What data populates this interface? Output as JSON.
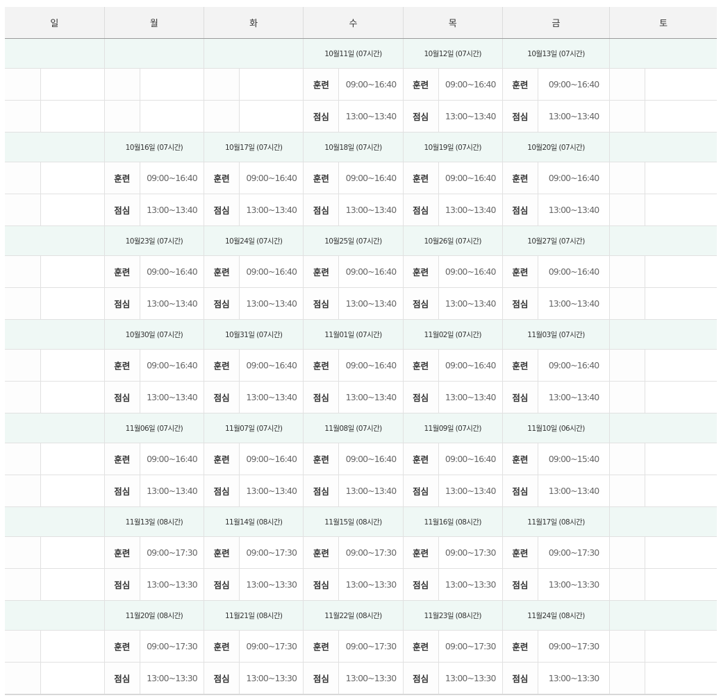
{
  "days": [
    "일",
    "월",
    "화",
    "수",
    "목",
    "금",
    "토"
  ],
  "weeks": [
    {
      "days": [
        null,
        null,
        null,
        {
          "date": "10월11일 (07시간)",
          "train_label": "훈련",
          "train": "09:00~16:40",
          "lunch_label": "점심",
          "lunch": "13:00~13:40"
        },
        {
          "date": "10월12일 (07시간)",
          "train_label": "훈련",
          "train": "09:00~16:40",
          "lunch_label": "점심",
          "lunch": "13:00~13:40"
        },
        {
          "date": "10월13일 (07시간)",
          "train_label": "훈련",
          "train": "09:00~16:40",
          "lunch_label": "점심",
          "lunch": "13:00~13:40"
        },
        null
      ]
    },
    {
      "days": [
        null,
        {
          "date": "10월16일 (07시간)",
          "train_label": "훈련",
          "train": "09:00~16:40",
          "lunch_label": "점심",
          "lunch": "13:00~13:40"
        },
        {
          "date": "10월17일 (07시간)",
          "train_label": "훈련",
          "train": "09:00~16:40",
          "lunch_label": "점심",
          "lunch": "13:00~13:40"
        },
        {
          "date": "10월18일 (07시간)",
          "train_label": "훈련",
          "train": "09:00~16:40",
          "lunch_label": "점심",
          "lunch": "13:00~13:40"
        },
        {
          "date": "10월19일 (07시간)",
          "train_label": "훈련",
          "train": "09:00~16:40",
          "lunch_label": "점심",
          "lunch": "13:00~13:40"
        },
        {
          "date": "10월20일 (07시간)",
          "train_label": "훈련",
          "train": "09:00~16:40",
          "lunch_label": "점심",
          "lunch": "13:00~13:40"
        },
        null
      ]
    },
    {
      "days": [
        null,
        {
          "date": "10월23일 (07시간)",
          "train_label": "훈련",
          "train": "09:00~16:40",
          "lunch_label": "점심",
          "lunch": "13:00~13:40"
        },
        {
          "date": "10월24일 (07시간)",
          "train_label": "훈련",
          "train": "09:00~16:40",
          "lunch_label": "점심",
          "lunch": "13:00~13:40"
        },
        {
          "date": "10월25일 (07시간)",
          "train_label": "훈련",
          "train": "09:00~16:40",
          "lunch_label": "점심",
          "lunch": "13:00~13:40"
        },
        {
          "date": "10월26일 (07시간)",
          "train_label": "훈련",
          "train": "09:00~16:40",
          "lunch_label": "점심",
          "lunch": "13:00~13:40"
        },
        {
          "date": "10월27일 (07시간)",
          "train_label": "훈련",
          "train": "09:00~16:40",
          "lunch_label": "점심",
          "lunch": "13:00~13:40"
        },
        null
      ]
    },
    {
      "days": [
        null,
        {
          "date": "10월30일 (07시간)",
          "train_label": "훈련",
          "train": "09:00~16:40",
          "lunch_label": "점심",
          "lunch": "13:00~13:40"
        },
        {
          "date": "10월31일 (07시간)",
          "train_label": "훈련",
          "train": "09:00~16:40",
          "lunch_label": "점심",
          "lunch": "13:00~13:40"
        },
        {
          "date": "11월01일 (07시간)",
          "train_label": "훈련",
          "train": "09:00~16:40",
          "lunch_label": "점심",
          "lunch": "13:00~13:40"
        },
        {
          "date": "11월02일 (07시간)",
          "train_label": "훈련",
          "train": "09:00~16:40",
          "lunch_label": "점심",
          "lunch": "13:00~13:40"
        },
        {
          "date": "11월03일 (07시간)",
          "train_label": "훈련",
          "train": "09:00~16:40",
          "lunch_label": "점심",
          "lunch": "13:00~13:40"
        },
        null
      ]
    },
    {
      "days": [
        null,
        {
          "date": "11월06일 (07시간)",
          "train_label": "훈련",
          "train": "09:00~16:40",
          "lunch_label": "점심",
          "lunch": "13:00~13:40"
        },
        {
          "date": "11월07일 (07시간)",
          "train_label": "훈련",
          "train": "09:00~16:40",
          "lunch_label": "점심",
          "lunch": "13:00~13:40"
        },
        {
          "date": "11월08일 (07시간)",
          "train_label": "훈련",
          "train": "09:00~16:40",
          "lunch_label": "점심",
          "lunch": "13:00~13:40"
        },
        {
          "date": "11월09일 (07시간)",
          "train_label": "훈련",
          "train": "09:00~16:40",
          "lunch_label": "점심",
          "lunch": "13:00~13:40"
        },
        {
          "date": "11월10일 (06시간)",
          "train_label": "훈련",
          "train": "09:00~15:40",
          "lunch_label": "점심",
          "lunch": "13:00~13:40"
        },
        null
      ]
    },
    {
      "days": [
        null,
        {
          "date": "11월13일 (08시간)",
          "train_label": "훈련",
          "train": "09:00~17:30",
          "lunch_label": "점심",
          "lunch": "13:00~13:30"
        },
        {
          "date": "11월14일 (08시간)",
          "train_label": "훈련",
          "train": "09:00~17:30",
          "lunch_label": "점심",
          "lunch": "13:00~13:30"
        },
        {
          "date": "11월15일 (08시간)",
          "train_label": "훈련",
          "train": "09:00~17:30",
          "lunch_label": "점심",
          "lunch": "13:00~13:30"
        },
        {
          "date": "11월16일 (08시간)",
          "train_label": "훈련",
          "train": "09:00~17:30",
          "lunch_label": "점심",
          "lunch": "13:00~13:30"
        },
        {
          "date": "11월17일 (08시간)",
          "train_label": "훈련",
          "train": "09:00~17:30",
          "lunch_label": "점심",
          "lunch": "13:00~13:30"
        },
        null
      ]
    },
    {
      "days": [
        null,
        {
          "date": "11월20일 (08시간)",
          "train_label": "훈련",
          "train": "09:00~17:30",
          "lunch_label": "점심",
          "lunch": "13:00~13:30"
        },
        {
          "date": "11월21일 (08시간)",
          "train_label": "훈련",
          "train": "09:00~17:30",
          "lunch_label": "점심",
          "lunch": "13:00~13:30"
        },
        {
          "date": "11월22일 (08시간)",
          "train_label": "훈련",
          "train": "09:00~17:30",
          "lunch_label": "점심",
          "lunch": "13:00~13:30"
        },
        {
          "date": "11월23일 (08시간)",
          "train_label": "훈련",
          "train": "09:00~17:30",
          "lunch_label": "점심",
          "lunch": "13:00~13:30"
        },
        {
          "date": "11월24일 (08시간)",
          "train_label": "훈련",
          "train": "09:00~17:30",
          "lunch_label": "점심",
          "lunch": "13:00~13:30"
        },
        null
      ]
    }
  ]
}
